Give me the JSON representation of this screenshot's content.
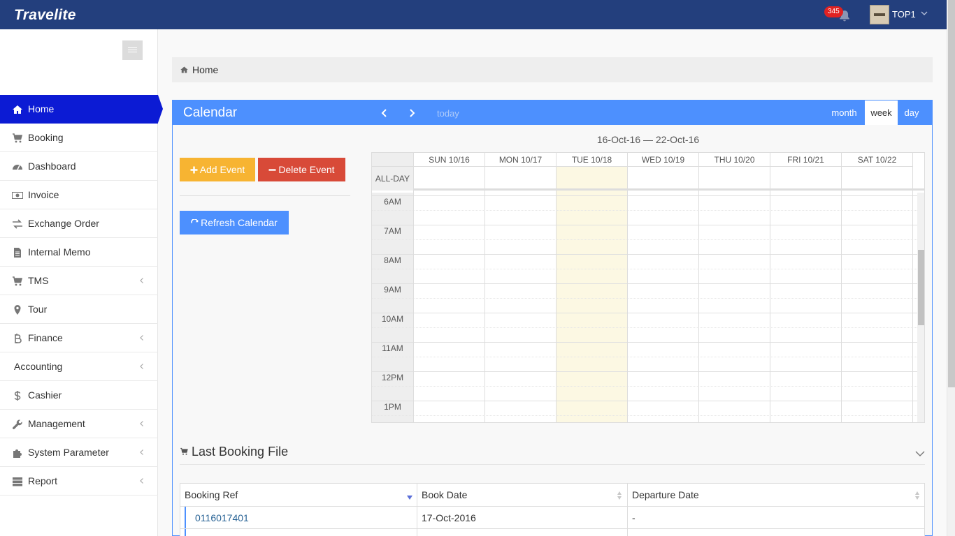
{
  "app": {
    "brand": "Travelite"
  },
  "header": {
    "notification_count": "345",
    "username": "TOP1"
  },
  "breadcrumb": {
    "label": "Home"
  },
  "sidebar": {
    "items": [
      {
        "label": "Home",
        "icon": "home-icon",
        "active": true
      },
      {
        "label": "Booking",
        "icon": "cart-icon"
      },
      {
        "label": "Dashboard",
        "icon": "dashboard-icon"
      },
      {
        "label": "Invoice",
        "icon": "money-icon"
      },
      {
        "label": "Exchange Order",
        "icon": "exchange-icon"
      },
      {
        "label": "Internal Memo",
        "icon": "file-icon"
      },
      {
        "label": "TMS",
        "icon": "cart-icon",
        "submenu": true
      },
      {
        "label": "Tour",
        "icon": "map-marker-icon"
      },
      {
        "label": "Finance",
        "icon": "bitcoin-icon",
        "submenu": true
      },
      {
        "label": "Accounting",
        "icon": "",
        "submenu": true
      },
      {
        "label": "Cashier",
        "icon": "dollar-icon"
      },
      {
        "label": "Management",
        "icon": "wrench-icon",
        "submenu": true
      },
      {
        "label": "System Parameter",
        "icon": "puzzle-icon",
        "submenu": true
      },
      {
        "label": "Report",
        "icon": "server-icon",
        "submenu": true
      }
    ]
  },
  "calendar": {
    "title": "Calendar",
    "today_label": "today",
    "views": {
      "month": "month",
      "week": "week",
      "day": "day"
    },
    "active_view": "week",
    "add_event": "Add Event",
    "delete_event": "Delete Event",
    "refresh": "Refresh Calendar",
    "date_range": "16-Oct-16 — 22-Oct-16",
    "allday_label": "ALL-DAY",
    "days": [
      "SUN 10/16",
      "MON 10/17",
      "TUE 10/18",
      "WED 10/19",
      "THU 10/20",
      "FRI 10/21",
      "SAT 10/22"
    ],
    "today_index": 2,
    "times": [
      "6AM",
      "7AM",
      "8AM",
      "9AM",
      "10AM",
      "11AM",
      "12PM",
      "1PM"
    ]
  },
  "last_booking": {
    "title": "Last Booking File",
    "columns": [
      "Booking Ref",
      "Book Date",
      "Departure Date"
    ],
    "rows": [
      {
        "booking_ref": "0116017401",
        "book_date": "17-Oct-2016",
        "departure_date": "-"
      }
    ]
  },
  "colors": {
    "topbar": "#233f7d",
    "sidebar_active": "#0c1bd4",
    "primary": "#4d90fe",
    "warning": "#f7b432",
    "danger": "#d84a38",
    "badge": "#e02222",
    "today_highlight": "#fcf8e3"
  }
}
